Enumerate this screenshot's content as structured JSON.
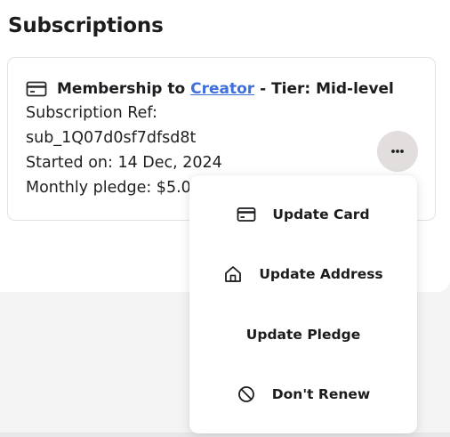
{
  "page": {
    "title": "Subscriptions"
  },
  "subscription": {
    "header_prefix": "Membership to ",
    "creator_name": "Creator",
    "header_suffix": " - Tier: Mid-level",
    "ref_label": "Subscription Ref:",
    "ref_value": "sub_1Q07d0sf7dfsd8t",
    "started_text": "Started on: 14 Dec, 2024",
    "pledge_text": "Monthly pledge: $5.00",
    "card_icon": "credit-card-icon",
    "more_icon": "ellipsis-icon"
  },
  "menu": {
    "items": [
      {
        "label": "Update Card",
        "icon": "credit-card-icon"
      },
      {
        "label": "Update Address",
        "icon": "home-icon"
      },
      {
        "label": "Update Pledge",
        "icon": ""
      },
      {
        "label": "Don't Renew",
        "icon": "block-icon"
      }
    ]
  },
  "colors": {
    "link": "#3f6fd8",
    "text": "#1c1c1e",
    "more_button_bg": "#e1dedd",
    "page_bg": "#f4f4f5"
  }
}
